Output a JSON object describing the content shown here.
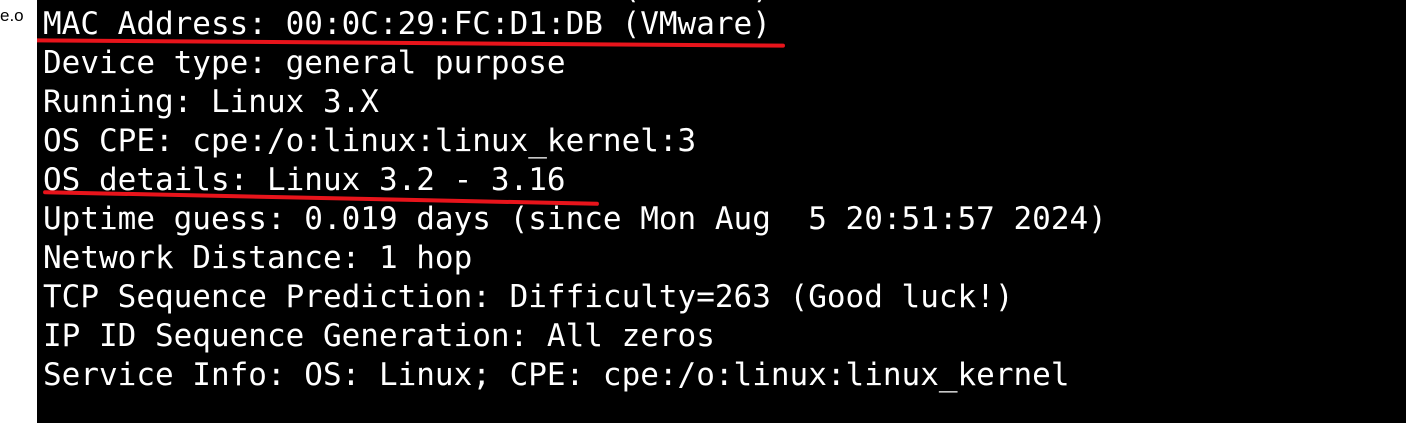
{
  "left_fragment": "e.o",
  "terminal": {
    "cutoff_line": "MAC Address: 00:0C:29:FC:D1:DB (VMware)",
    "lines": [
      "MAC Address: 00:0C:29:FC:D1:DB (VMware)",
      "Device type: general purpose",
      "Running: Linux 3.X",
      "OS CPE: cpe:/o:linux:linux_kernel:3",
      "OS details: Linux 3.2 - 3.16",
      "Uptime guess: 0.019 days (since Mon Aug  5 20:51:57 2024)",
      "Network Distance: 1 hop",
      "TCP Sequence Prediction: Difficulty=263 (Good luck!)",
      "IP ID Sequence Generation: All zeros",
      "Service Info: OS: Linux; CPE: cpe:/o:linux:linux_kernel"
    ]
  },
  "annotations": {
    "underline_color": "#e8141b",
    "underlined_lines": [
      0,
      4
    ]
  },
  "colors": {
    "terminal_background": "#000000",
    "terminal_text": "#ffffff",
    "page_background": "#ffffff"
  }
}
